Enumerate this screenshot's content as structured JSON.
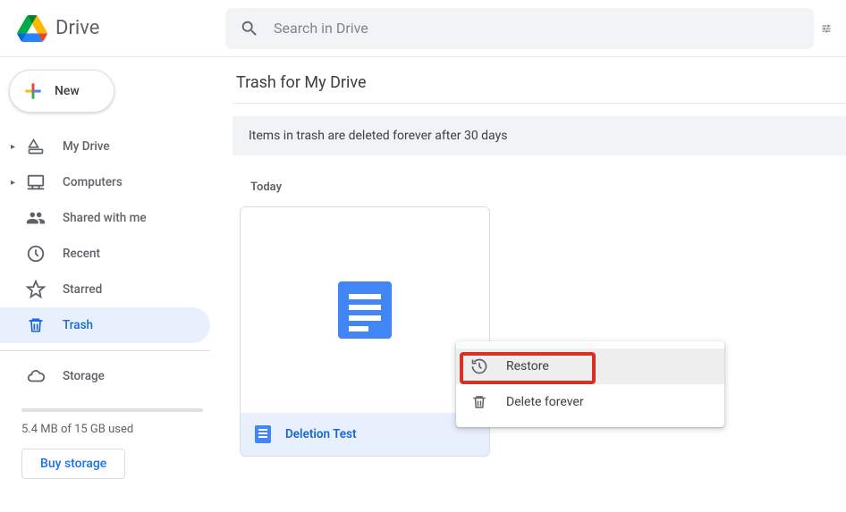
{
  "app": {
    "name": "Drive"
  },
  "search": {
    "placeholder": "Search in Drive"
  },
  "newButton": {
    "label": "New"
  },
  "nav": {
    "myDrive": "My Drive",
    "computers": "Computers",
    "shared": "Shared with me",
    "recent": "Recent",
    "starred": "Starred",
    "trash": "Trash",
    "storage": "Storage"
  },
  "storage": {
    "text": "5.4 MB of 15 GB used",
    "buy": "Buy storage"
  },
  "page": {
    "title": "Trash for My Drive",
    "banner": "Items in trash are deleted forever after 30 days",
    "section": "Today"
  },
  "file": {
    "name": "Deletion Test"
  },
  "menu": {
    "restore": "Restore",
    "deleteForever": "Delete forever"
  }
}
